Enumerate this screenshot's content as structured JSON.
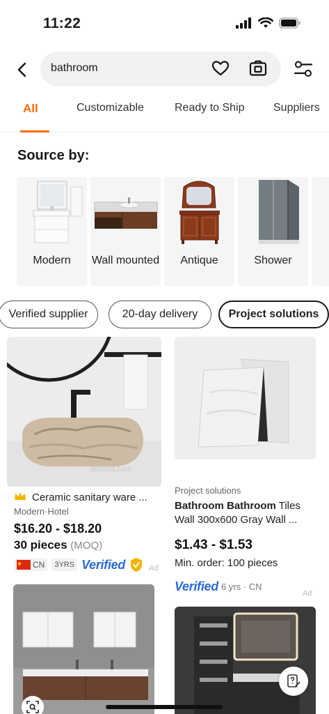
{
  "status_bar": {
    "time": "11:22"
  },
  "search": {
    "query": "bathroom"
  },
  "tabs": [
    {
      "label": "All",
      "active": true
    },
    {
      "label": "Customizable"
    },
    {
      "label": "Ready to Ship"
    },
    {
      "label": "Suppliers"
    }
  ],
  "source_by": {
    "title": "Source by:",
    "categories": [
      {
        "label": "Modern"
      },
      {
        "label": "Wall mounted"
      },
      {
        "label": "Antique"
      },
      {
        "label": "Shower"
      }
    ]
  },
  "chips": [
    {
      "label": "Verified supplier"
    },
    {
      "label": "20-day delivery"
    },
    {
      "label": "Project solutions",
      "selected": true
    }
  ],
  "products": [
    {
      "title": "Ceramic sanitary ware ...",
      "subtitle": "Modern·Hotel",
      "price": "$16.20 - $18.20",
      "moq_qty": "30 pieces",
      "moq_label": "(MOQ)",
      "country": "CN",
      "years": "3YRS",
      "verified": "Verified",
      "ad": "Ad",
      "watermark": "alibaba.com"
    },
    {
      "tag": "Project solutions",
      "title_bold": "Bathroom Bathroom",
      "title_rest": " Tiles",
      "title_line2": "Wall 300x600 Gray Wall ...",
      "price": "$1.43 - $1.53",
      "min_order": "Min. order: 100 pieces",
      "verified": "Verified",
      "supplier_meta": "6 yrs · CN",
      "ad": "Ad"
    }
  ],
  "colors": {
    "accent": "#ff6a00",
    "verified_blue": "#2a6ad6",
    "gold": "#f5b400"
  }
}
